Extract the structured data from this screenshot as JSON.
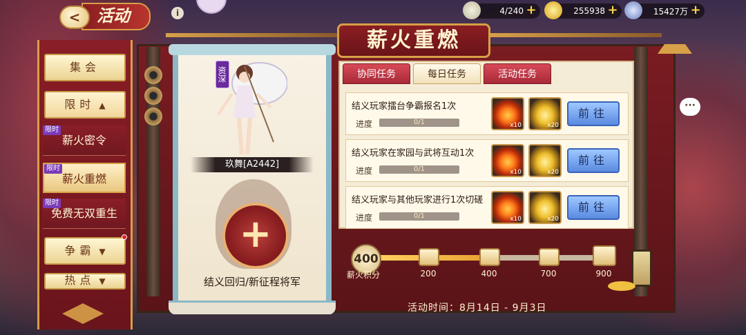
{
  "header": {
    "back_label": "<",
    "title": "活动",
    "info_label": "i"
  },
  "resources": [
    {
      "icon": "silver-ingot-icon",
      "value": "4/240",
      "plus": "+"
    },
    {
      "icon": "gold-ingot-icon",
      "value": "255938",
      "plus": "+"
    },
    {
      "icon": "gem-icon",
      "value": "15427万",
      "plus": "+"
    }
  ],
  "menu": {
    "jihui": "集会",
    "xianshi": "限时",
    "items": [
      {
        "tag": "限时",
        "label": "薪火密令"
      },
      {
        "tag": "限时",
        "label": "薪火重燃"
      },
      {
        "tag": "限时",
        "label": "免费无双重生"
      }
    ],
    "zhengba": "争霸",
    "redian": "热点"
  },
  "event": {
    "title": "薪火重燃",
    "character_badge": "资深",
    "character_name": "玖舞[A2442]",
    "add_symbol": "+",
    "recruit_label": "结义回归/新征程将军",
    "time": "活动时间：8月14日 - 9月3日"
  },
  "tabs": [
    {
      "label": "协同任务",
      "active": false
    },
    {
      "label": "每日任务",
      "active": true
    },
    {
      "label": "活动任务",
      "active": false
    }
  ],
  "tasks": [
    {
      "title": "结义玩家擂台争霸报名1次",
      "progress_label": "进度",
      "progress": "0/1",
      "progress_fraction": 0,
      "rewards": [
        {
          "type": "fire",
          "qty": "x10"
        },
        {
          "type": "gold",
          "qty": "x20"
        }
      ],
      "button": "前往"
    },
    {
      "title": "结义玩家在家园与武将互动1次",
      "progress_label": "进度",
      "progress": "0/1",
      "progress_fraction": 0,
      "rewards": [
        {
          "type": "fire",
          "qty": "x10"
        },
        {
          "type": "gold",
          "qty": "x20"
        }
      ],
      "button": "前往"
    },
    {
      "title": "结义玩家与其他玩家进行1次切磋",
      "progress_label": "进度",
      "progress": "0/1",
      "progress_fraction": 0,
      "rewards": [
        {
          "type": "fire",
          "qty": "x10"
        },
        {
          "type": "gold",
          "qty": "x20"
        }
      ],
      "button": "前往"
    }
  ],
  "points": {
    "current": "400",
    "label": "薪火积分",
    "fill_fraction": 0.5,
    "milestones": [
      "200",
      "400",
      "700",
      "900"
    ]
  },
  "chat_label": "···",
  "colors": {
    "primary_red": "#8a1e22",
    "gold": "#d8a048",
    "button_blue": "#5a8ae0",
    "parchment": "#f5ecd8"
  }
}
